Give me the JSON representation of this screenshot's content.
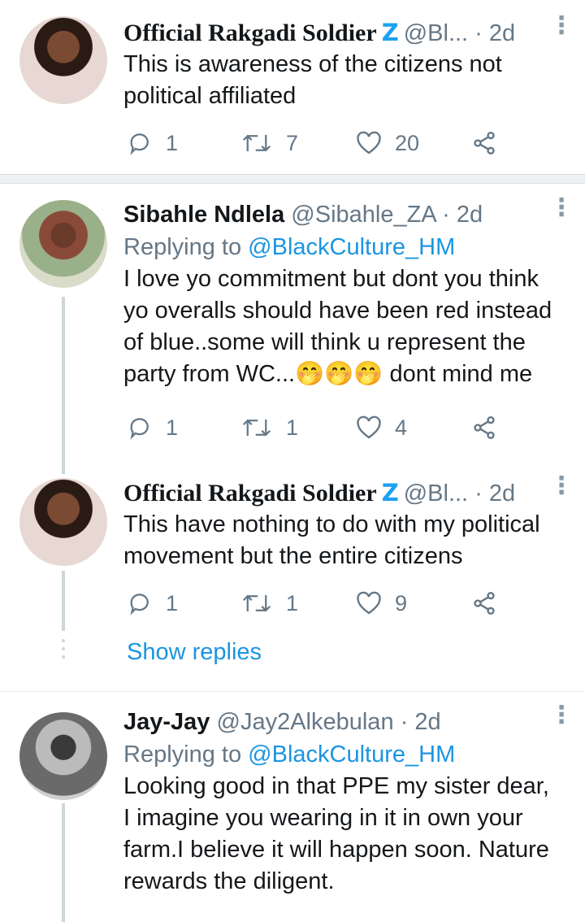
{
  "tweets": [
    {
      "name": "Official Rakgadi Soldier",
      "badge": "Z",
      "handle": "@Bl...",
      "dot": "·",
      "time": "2d",
      "text_lines": [
        "This is awareness of the citizens not",
        "political affiliated"
      ],
      "replies": "1",
      "retweets": "7",
      "likes": "20"
    },
    {
      "name": "Sibahle Ndlela",
      "handle": "@Sibahle_ZA",
      "dot": "·",
      "time": "2d",
      "replying_prefix": "Replying to",
      "replying_to": "@BlackCulture_HM",
      "text_lines": [
        "I love yo commitment but dont you think",
        "yo overalls should have been red instead",
        "of blue..some will think u represent the",
        "party from  WC...🤭🤭🤭 dont mind me"
      ],
      "replies": "1",
      "retweets": "1",
      "likes": "4"
    },
    {
      "name": "Official Rakgadi Soldier",
      "badge": "Z",
      "handle": "@Bl...",
      "dot": "·",
      "time": "2d",
      "text_lines": [
        "This have nothing to do with my political",
        "movement but the entire citizens"
      ],
      "replies": "1",
      "retweets": "1",
      "likes": "9"
    },
    {
      "name": "Jay-Jay",
      "handle": "@Jay2Alkebulan",
      "dot": "·",
      "time": "2d",
      "replying_prefix": "Replying to",
      "replying_to": "@BlackCulture_HM",
      "text_lines": [
        "Looking good in that PPE my sister dear,",
        "I imagine you wearing in it in own your",
        "farm.I believe it will happen soon. Nature",
        "rewards the diligent."
      ]
    }
  ],
  "show_replies": "Show replies",
  "icons": {
    "reply": "reply-bubble-icon",
    "retweet": "retweet-icon",
    "like": "heart-icon",
    "share": "share-icon",
    "more": "vertical-dots-icon"
  },
  "colors": {
    "link": "#1b95e0",
    "muted": "#657786",
    "badge": "#1da1f2"
  }
}
